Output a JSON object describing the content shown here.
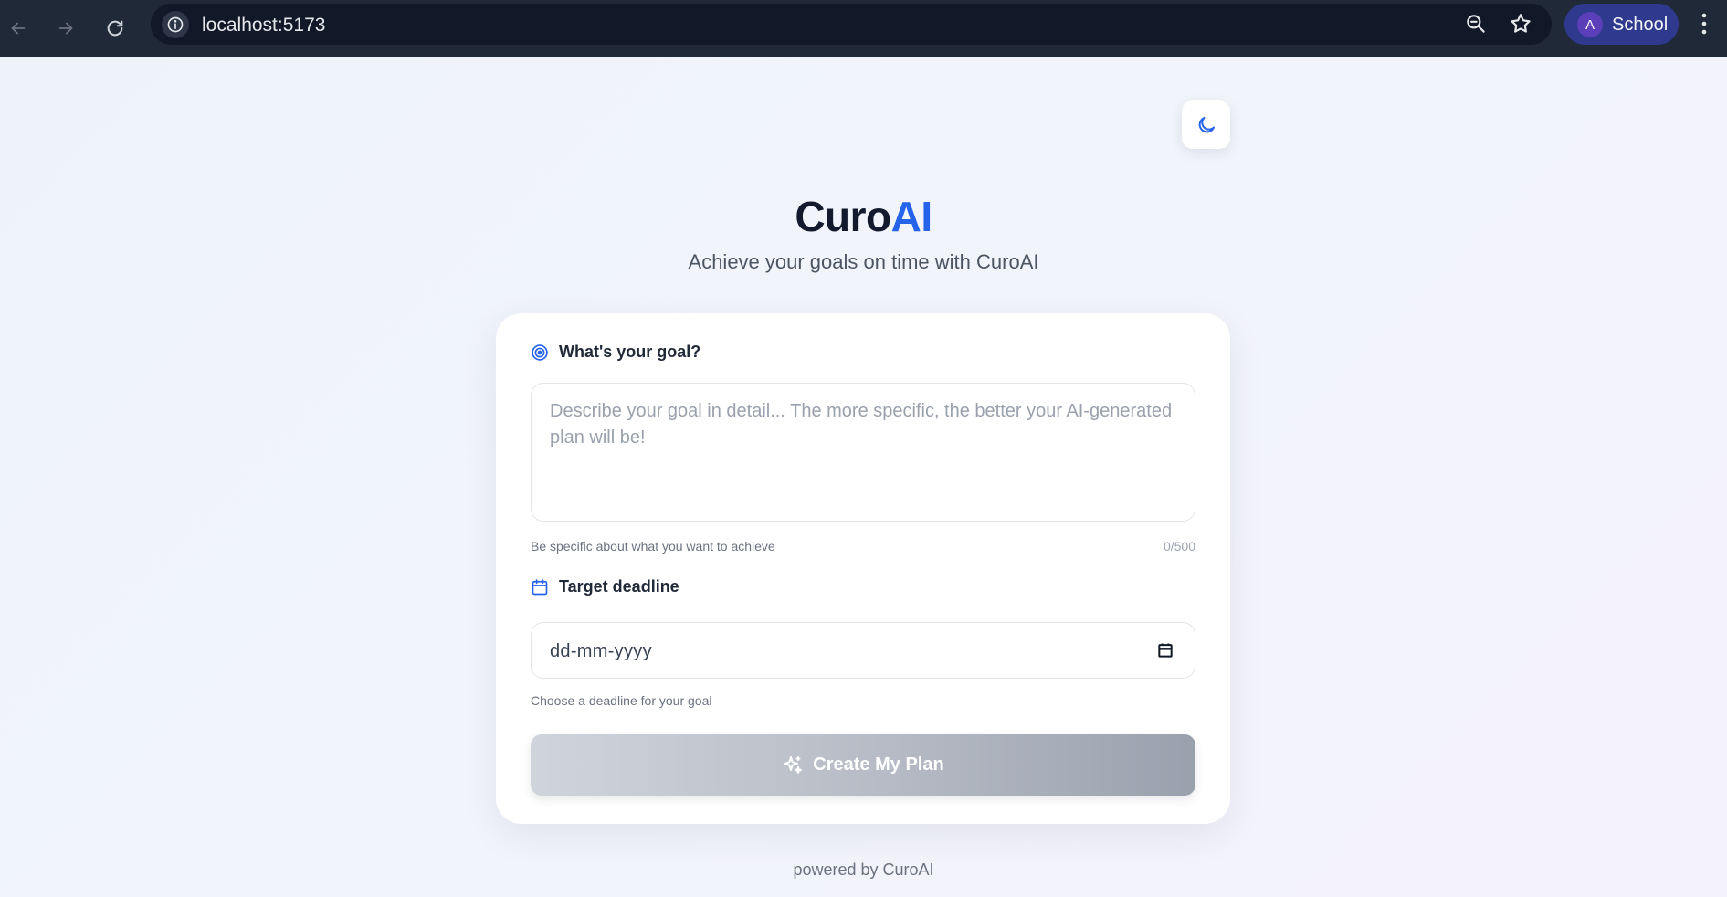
{
  "browser": {
    "url": "localhost:5173",
    "profile_initial": "A",
    "profile_name": "School",
    "icons": [
      "back-icon",
      "forward-icon",
      "reload-icon",
      "site-info-icon",
      "zoom-icon",
      "bookmark-star-icon",
      "menu-dots-icon"
    ]
  },
  "header": {
    "brand_main": "Curo",
    "brand_accent": "AI",
    "tagline": "Achieve your goals on time with CuroAI",
    "theme_toggle_icon": "moon-icon"
  },
  "form": {
    "goal": {
      "label": "What's your goal?",
      "icon": "target-icon",
      "placeholder": "Describe your goal in detail... The more specific, the better your AI-generated plan will be!",
      "value": "",
      "hint": "Be specific about what you want to achieve",
      "counter": "0/500"
    },
    "deadline": {
      "label": "Target deadline",
      "icon": "calendar-icon",
      "placeholder": "dd-mm-yyyy",
      "hint": "Choose a deadline for your goal"
    },
    "submit": {
      "label": "Create My Plan",
      "icon": "sparkles-icon",
      "enabled": false
    }
  },
  "footer": {
    "text": "powered by CuroAI"
  },
  "colors": {
    "accent": "#2563eb",
    "brand_dark": "#141a2e",
    "chrome_bg": "#1f2937",
    "profile_bg": "#2f3a8f"
  }
}
